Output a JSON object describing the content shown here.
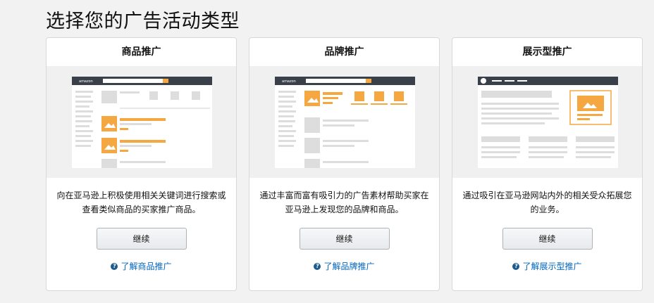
{
  "page": {
    "title": "选择您的广告活动类型"
  },
  "cards": [
    {
      "title": "商品推广",
      "description": "向在亚马逊上积极使用相关关键词进行搜索或查看类似商品的买家推广商品。",
      "button_label": "继续",
      "learn_more": "了解商品推广"
    },
    {
      "title": "品牌推广",
      "description": "通过丰富而富有吸引力的广告素材帮助买家在亚马逊上发现您的品牌和商品。",
      "button_label": "继续",
      "learn_more": "了解品牌推广"
    },
    {
      "title": "展示型推广",
      "description": "通过吸引在亚马逊网站内外的相关受众拓展您的业务。",
      "button_label": "继续",
      "learn_more": "了解展示型推广"
    }
  ],
  "illustration": {
    "logo_text": "amazon"
  },
  "icons": {
    "help": "question-circle-icon",
    "help_glyph": "?"
  },
  "colors": {
    "accent": "#f5a742",
    "link": "#0066c0",
    "dark_bar": "#3a4049"
  }
}
